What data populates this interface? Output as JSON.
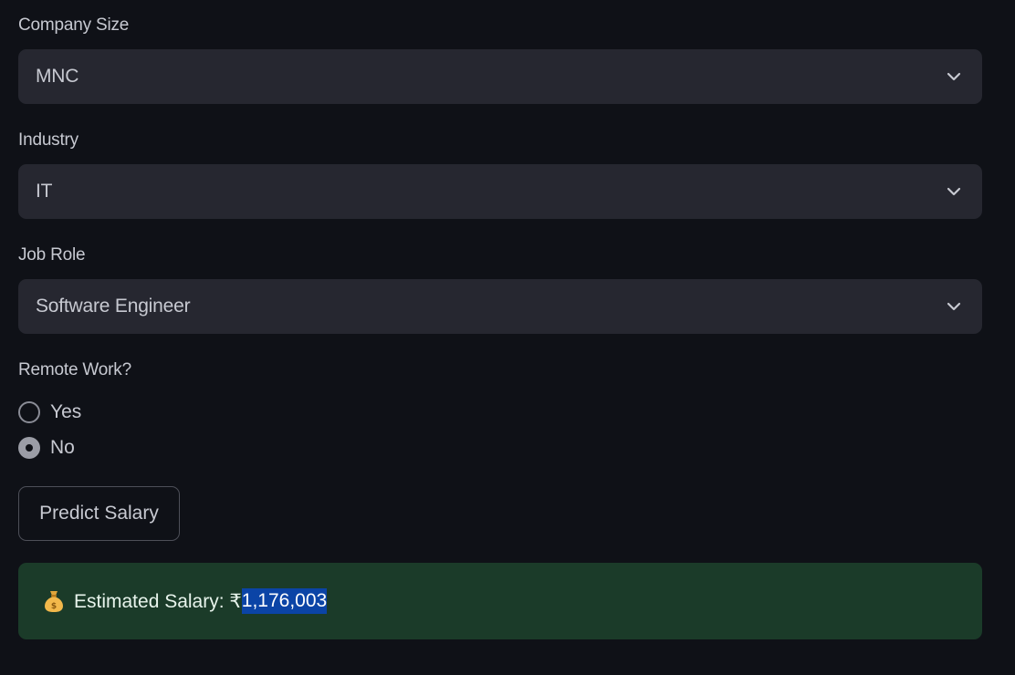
{
  "form": {
    "company_size": {
      "label": "Company Size",
      "value": "MNC"
    },
    "industry": {
      "label": "Industry",
      "value": "IT"
    },
    "job_role": {
      "label": "Job Role",
      "value": "Software Engineer"
    },
    "remote_work": {
      "label": "Remote Work?",
      "options": [
        {
          "label": "Yes",
          "selected": false
        },
        {
          "label": "No",
          "selected": true
        }
      ]
    },
    "predict_button": {
      "label": "Predict Salary"
    }
  },
  "result": {
    "icon": "money-bag-icon",
    "prefix": "Estimated Salary: ₹",
    "amount": "1,176,003",
    "background_color": "#1b3b29",
    "highlight_color": "#0b44a6"
  }
}
